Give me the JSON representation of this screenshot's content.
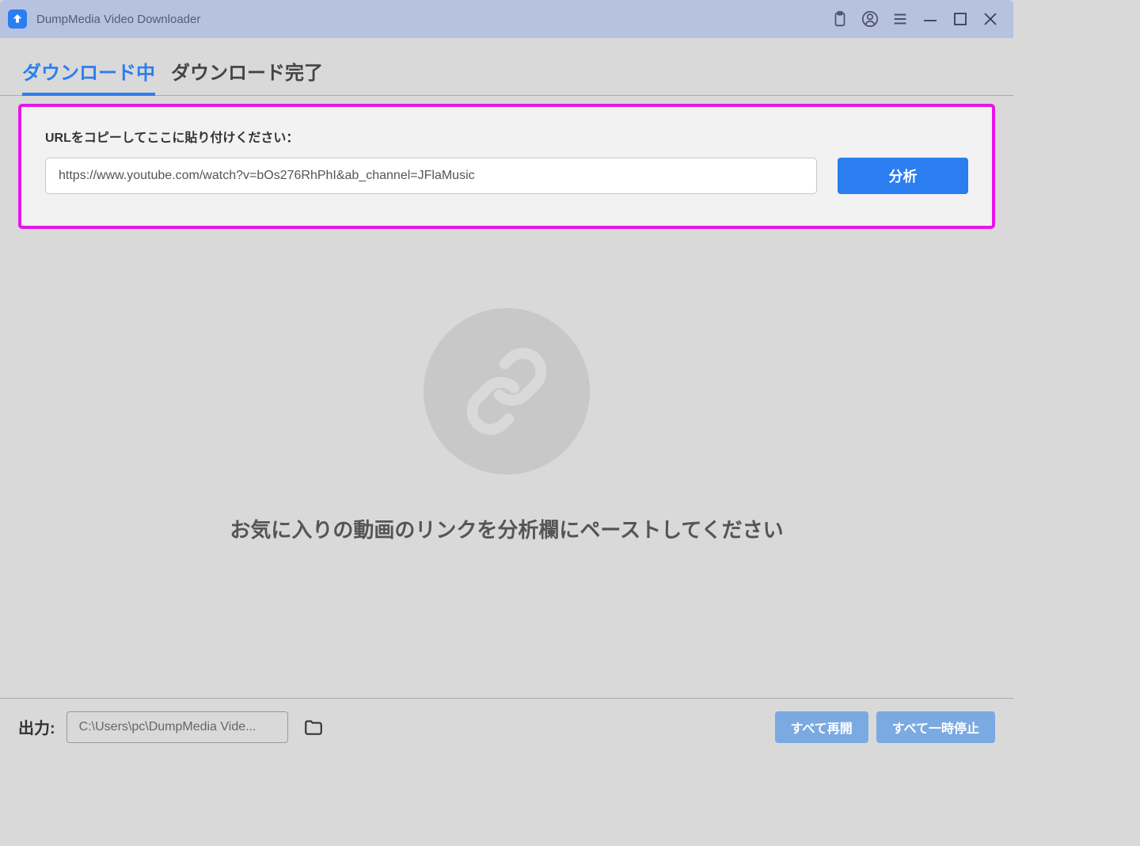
{
  "titlebar": {
    "title": "DumpMedia Video Downloader"
  },
  "tabs": {
    "downloading": "ダウンロード中",
    "completed": "ダウンロード完了"
  },
  "url_section": {
    "label": "URLをコピーしてここに貼り付けください：",
    "input_value": "https://www.youtube.com/watch?v=bOs276RhPhI&ab_channel=JFlaMusic",
    "analyze_button": "分析"
  },
  "empty_state": {
    "message": "お気に入りの動画のリンクを分析欄にペーストしてください"
  },
  "footer": {
    "output_label": "出力:",
    "output_path": "C:\\Users\\pc\\DumpMedia Vide...",
    "resume_all": "すべて再開",
    "pause_all": "すべて一時停止"
  }
}
